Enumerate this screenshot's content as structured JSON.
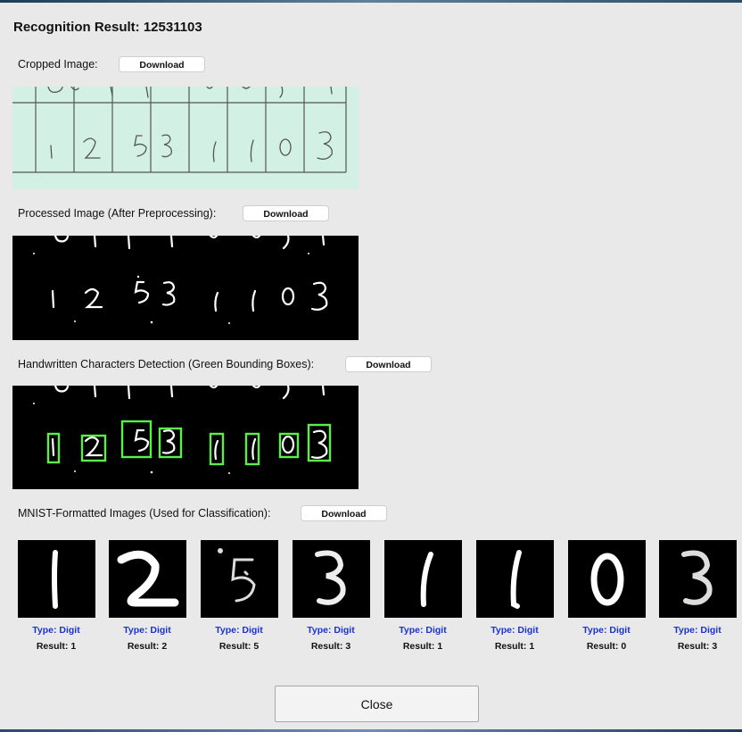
{
  "dialog": {
    "title": "Recognition Result: 12531103",
    "close_label": "Close"
  },
  "sections": {
    "cropped": {
      "label": "Cropped Image:",
      "button": "Download"
    },
    "processed": {
      "label": "Processed Image (After Preprocessing):",
      "button": "Download"
    },
    "detection": {
      "label": "Handwritten Characters Detection (Green Bounding Boxes):",
      "button": "Download"
    },
    "mnist": {
      "label": "MNIST-Formatted Images (Used for Classification):",
      "button": "Download"
    }
  },
  "digits": [
    {
      "type": "Type: Digit",
      "result": "Result: 1"
    },
    {
      "type": "Type: Digit",
      "result": "Result: 2"
    },
    {
      "type": "Type: Digit",
      "result": "Result: 5"
    },
    {
      "type": "Type: Digit",
      "result": "Result: 3"
    },
    {
      "type": "Type: Digit",
      "result": "Result: 1"
    },
    {
      "type": "Type: Digit",
      "result": "Result: 1"
    },
    {
      "type": "Type: Digit",
      "result": "Result: 0"
    },
    {
      "type": "Type: Digit",
      "result": "Result: 3"
    }
  ],
  "colors": {
    "type_text": "#1a33cc",
    "bounding_box": "#5bef4a",
    "cropped_background": "#d3f0e4"
  }
}
